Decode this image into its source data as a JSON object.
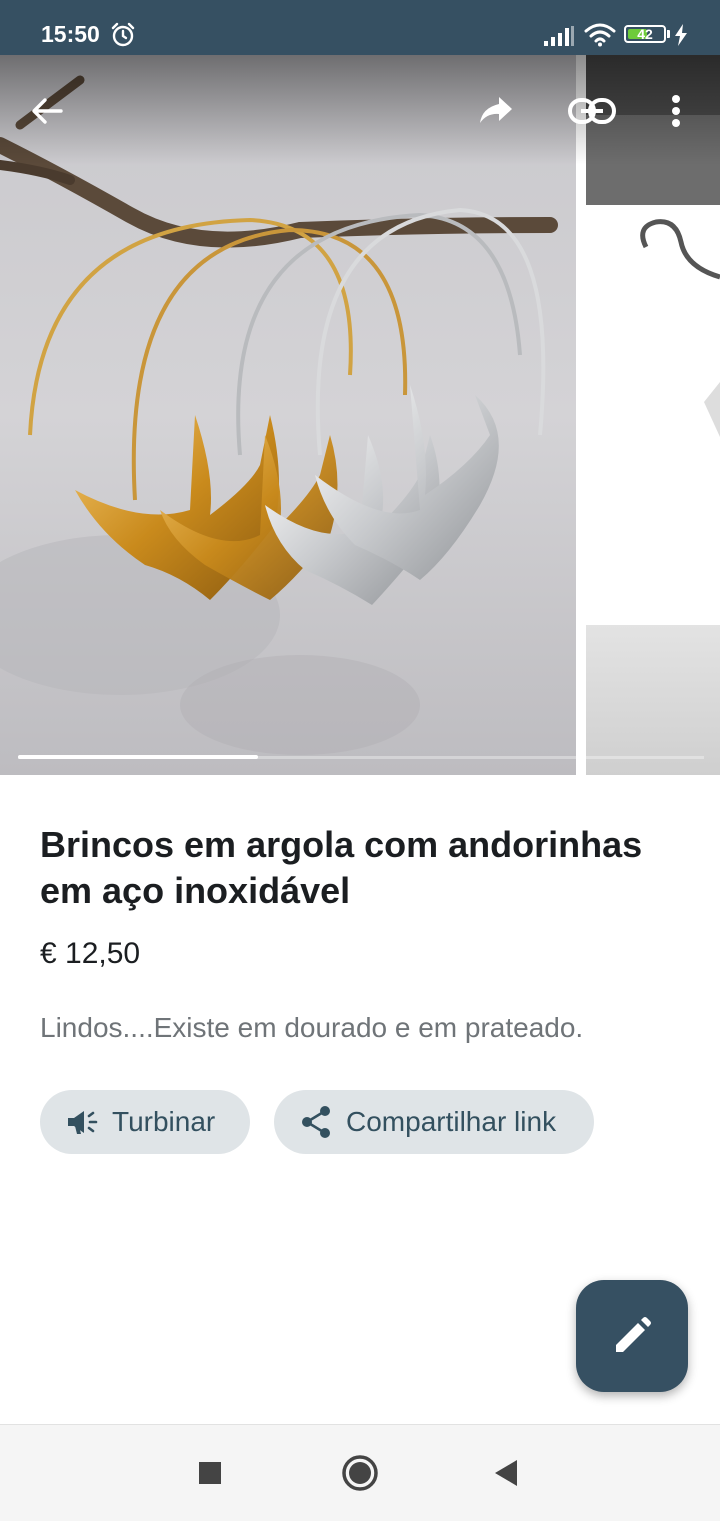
{
  "status_bar": {
    "time": "15:50",
    "battery_level": "42",
    "background": "#365062"
  },
  "gallery": {
    "photo_count_visible": 1,
    "progress_fraction": 0.35
  },
  "listing": {
    "title": "Brincos em argola com andorinhas em aço inoxidável",
    "price": "€ 12,50",
    "description": "Lindos....Existe em dourado e em prateado."
  },
  "actions": {
    "turbinar_label": "Turbinar",
    "share_label": "Compartilhar link"
  },
  "theme": {
    "accent": "#365062",
    "chip_bg": "#dfe4e7",
    "chip_text": "#33505f"
  },
  "icons": {
    "back": "arrow-left",
    "share": "share-arrow",
    "link": "link",
    "more": "more-vertical",
    "turbinar": "megaphone",
    "share_link": "share-nodes",
    "edit": "pencil"
  }
}
